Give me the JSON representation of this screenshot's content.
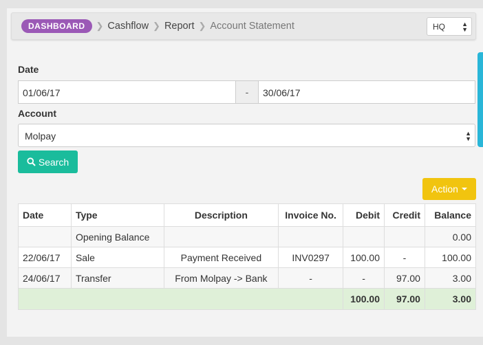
{
  "breadcrumb": {
    "items": [
      "DASHBOARD",
      "Cashflow",
      "Report",
      "Account Statement"
    ]
  },
  "branch_select": {
    "value": "HQ"
  },
  "form": {
    "date_label": "Date",
    "date_from": "01/06/17",
    "date_separator": "-",
    "date_to": "30/06/17",
    "account_label": "Account",
    "account_value": "Molpay",
    "search_label": "Search"
  },
  "action_label": "Action",
  "table": {
    "headers": [
      "Date",
      "Type",
      "Description",
      "Invoice No.",
      "Debit",
      "Credit",
      "Balance"
    ],
    "rows": [
      [
        "",
        "Opening Balance",
        "",
        "",
        "",
        "",
        "0.00"
      ],
      [
        "22/06/17",
        "Sale",
        "Payment Received",
        "INV0297",
        "100.00",
        "-",
        "100.00"
      ],
      [
        "24/06/17",
        "Transfer",
        "From Molpay -> Bank",
        "-",
        "-",
        "97.00",
        "3.00"
      ]
    ],
    "totals": {
      "debit": "100.00",
      "credit": "97.00",
      "balance": "3.00"
    }
  },
  "colors": {
    "badge": "#9b59b6",
    "search_button": "#1abc9c",
    "action_button": "#f1c40f",
    "total_row": "#dff0d8",
    "side_tab": "#29b6d8"
  }
}
